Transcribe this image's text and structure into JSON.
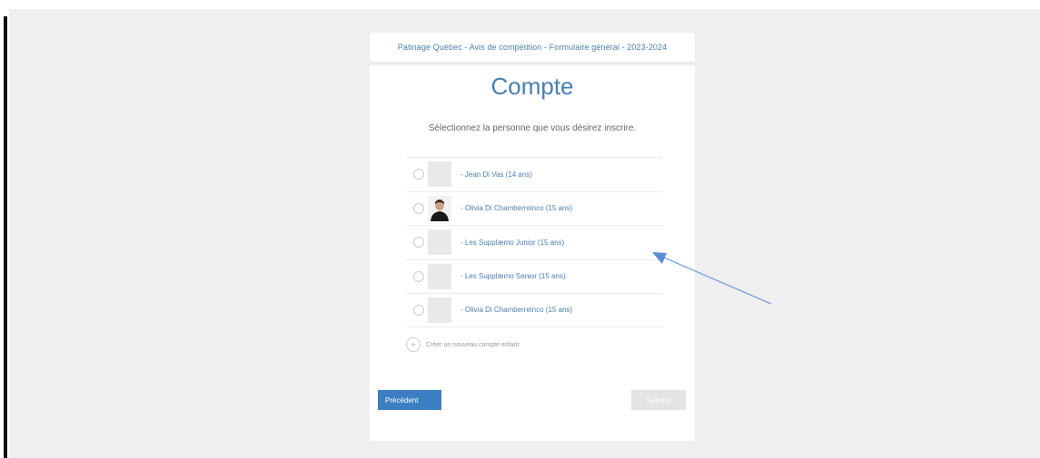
{
  "header": {
    "title": "Patinage Québec - Avis de compétition - Formulaire général - 2023-2024"
  },
  "card": {
    "title": "Compte",
    "subtitle": "Sélectionnez la personne que vous désirez inscrire."
  },
  "persons": [
    {
      "label": "- Jean Di Vas (14 ans)",
      "has_photo": false
    },
    {
      "label": "- Olivia Di Chamberreinco (15 ans)",
      "has_photo": true
    },
    {
      "label": "- Les Supplæmo Junior (15 ans)",
      "has_photo": false
    },
    {
      "label": "- Les Supplæmo Senior (15 ans)",
      "has_photo": false
    },
    {
      "label": "- Olivia Di Chamberreinco (15 ans)",
      "has_photo": false
    }
  ],
  "add_person": {
    "label": "Créer un nouveau compte enfant"
  },
  "buttons": {
    "previous": "Précédent",
    "next": "Suivant"
  },
  "colors": {
    "accent": "#3b7fc2",
    "link": "#4a7fb0",
    "backdrop": "#efefef",
    "annotation_arrow": "#5b8fd6"
  }
}
